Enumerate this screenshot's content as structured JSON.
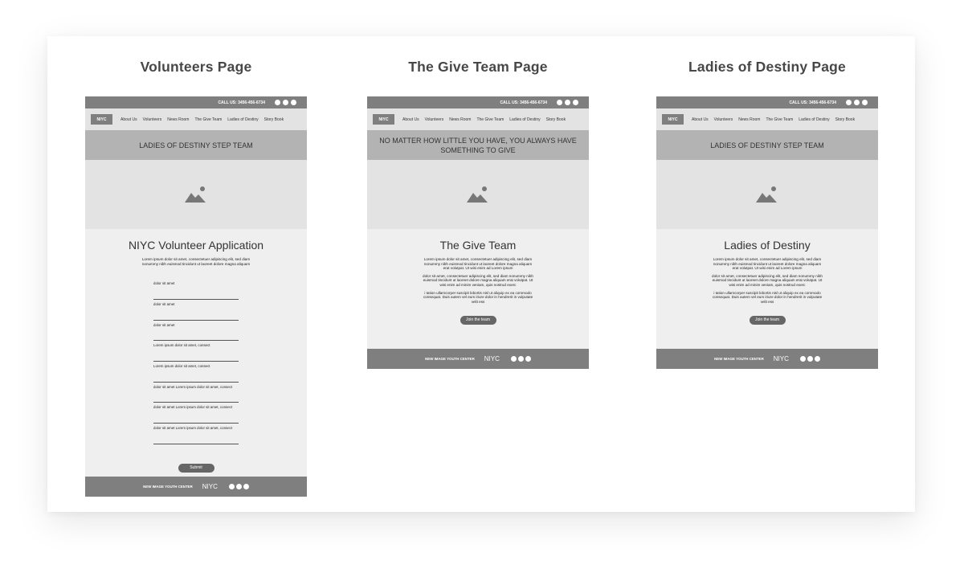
{
  "pages": [
    {
      "heading": "Volunteers Page",
      "call": "CALL US: 3456-456-6734",
      "logo": "NIYC",
      "nav": [
        "About Us",
        "Volunteers",
        "News Room",
        "The Give Team",
        "Ladies of Destiny",
        "Story Book"
      ],
      "banner": "LADIES OF DESTINY STEP TEAM",
      "title": "NIYC Volunteer Application",
      "paragraphs": [
        "Lorem ipsum dolor sit amet, consectetuer adipiscing elit, sed diam nonummy nibh euismod tincidunt ut laoreet dolore magna aliquam"
      ],
      "fields": [
        "dolor sit amet",
        "dolor sit amet",
        "dolor sit amet",
        "Lorem ipsum dolor sit amet, consect",
        "Lorem ipsum dolor sit amet, consect",
        "dolor sit amet Lorem ipsum dolor sit amet, consect",
        "dolor sit amet Lorem ipsum dolor sit amet, consect",
        "dolor sit amet Lorem ipsum dolor sit amet, consect"
      ],
      "button": "Submit",
      "footer_text": "NEW IMAGE YOUTH CENTER",
      "footer_logo": "NIYC"
    },
    {
      "heading": "The Give Team Page",
      "call": "CALL US: 3456-456-6734",
      "logo": "NIYC",
      "nav": [
        "About Us",
        "Volunteers",
        "News Room",
        "The Give Team",
        "Ladies of Destiny",
        "Story Book"
      ],
      "banner": "NO MATTER HOW LITTLE YOU HAVE, YOU ALWAYS HAVE SOMETHING TO GIVE",
      "title": "The Give Team",
      "paragraphs": [
        "Lorem ipsum dolor sit amet, consectetuer adipiscing elit, sed diam nonummy nibh euismod tincidunt ut laoreet dolore magna aliquam erat volutpat. Ut wisi enim ad Lorem ipsum",
        "dolor sit amet, consectetuer adipiscing elit, sed diam nonummy nibh euismod tincidunt ut laoreet dolore magna aliquam erat volutpat. Ut wisi enim ad minim veniam, quis nostrud exerc",
        "i tation ullamcorper suscipit lobortis nisl ut aliquip ex ea commodo consequat. Duis autem vel eum iriure dolor in hendrerit in vulputate velit ess"
      ],
      "button": "Join the team",
      "footer_text": "NEW IMAGE YOUTH CENTER",
      "footer_logo": "NIYC"
    },
    {
      "heading": "Ladies of Destiny Page",
      "call": "CALL US: 3456-456-6734",
      "logo": "NIYC",
      "nav": [
        "About Us",
        "Volunteers",
        "News Room",
        "The Give Team",
        "Ladies of Destiny",
        "Story Book"
      ],
      "banner": "LADIES OF DESTINY STEP TEAM",
      "title": "Ladies of Destiny",
      "paragraphs": [
        "Lorem ipsum dolor sit amet, consectetuer adipiscing elit, sed diam nonummy nibh euismod tincidunt ut laoreet dolore magna aliquam erat volutpat. Ut wisi enim ad Lorem ipsum",
        "dolor sit amet, consectetuer adipiscing elit, sed diam nonummy nibh euismod tincidunt ut laoreet dolore magna aliquam erat volutpat. Ut wisi enim ad minim veniam, quis nostrud exerc",
        "i tation ullamcorper suscipit lobortis nisl ut aliquip ex ea commodo consequat. Duis autem vel eum iriure dolor in hendrerit in vulputate velit ess"
      ],
      "button": "Join the team",
      "footer_text": "NEW IMAGE YOUTH CENTER",
      "footer_logo": "NIYC"
    }
  ]
}
